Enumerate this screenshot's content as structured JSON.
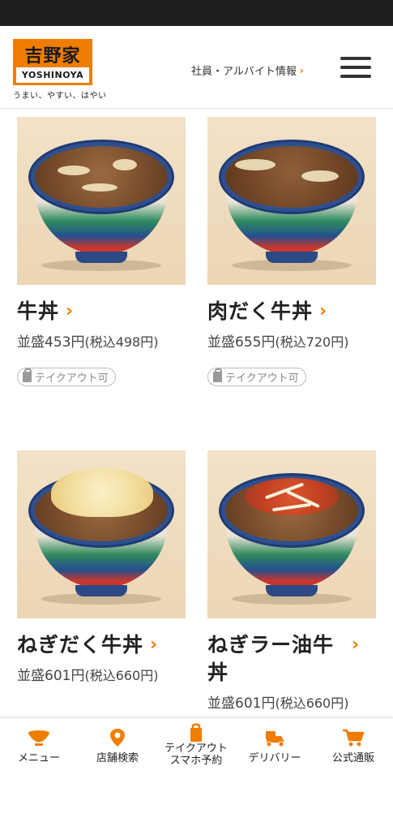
{
  "header": {
    "logo_kanji": "吉野家",
    "logo_roman": "YOSHINOYA",
    "tagline": "うまい、やすい、はやい",
    "recruit_link": "社員・アルバイト情報",
    "recruit_chevron": "›"
  },
  "menu_items": [
    {
      "name": "牛丼",
      "price": "並盛453円",
      "tax": "(税込498円)",
      "badge": "テイクアウト可",
      "topping": "beef-onion"
    },
    {
      "name": "肉だく牛丼",
      "price": "並盛655円",
      "tax": "(税込720円)",
      "badge": "テイクアウト可",
      "topping": "extra-beef"
    },
    {
      "name": "ねぎだく牛丼",
      "price": "並盛601円",
      "tax": "(税込660円)",
      "badge": "",
      "topping": "onion"
    },
    {
      "name": "ねぎラー油牛丼",
      "price": "並盛601円",
      "tax": "(税込660円)",
      "badge": "",
      "topping": "leek-chili-oil"
    }
  ],
  "chevron": "›",
  "bottom_nav": [
    {
      "label": "メニュー",
      "icon": "bowl-icon"
    },
    {
      "label": "店舗検索",
      "icon": "map-pin-icon"
    },
    {
      "label_line1": "テイクアウト",
      "label_line2": "スマホ予約",
      "icon": "takeout-bag-icon"
    },
    {
      "label": "デリバリー",
      "icon": "delivery-scooter-icon"
    },
    {
      "label": "公式通販",
      "icon": "shopping-cart-icon"
    }
  ],
  "colors": {
    "accent": "#ef7d00",
    "status_bar": "#1e1e1e"
  }
}
